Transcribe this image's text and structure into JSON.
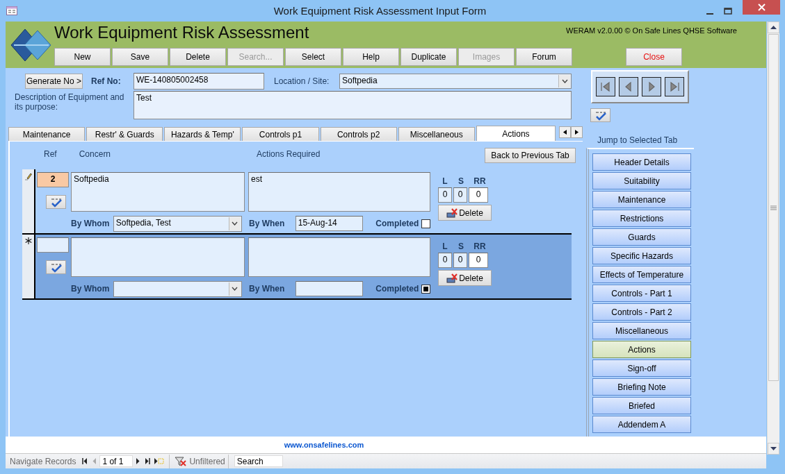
{
  "window": {
    "title": "Work Equipment Risk Assessment Input Form"
  },
  "header": {
    "title": "Work Equipment Risk Assessment",
    "version": "WERAM v2.0.00 © On Safe Lines QHSE Software",
    "buttons": [
      {
        "label": "New",
        "disabled": false
      },
      {
        "label": "Save",
        "disabled": false
      },
      {
        "label": "Delete",
        "disabled": false
      },
      {
        "label": "Search...",
        "disabled": true
      },
      {
        "label": "Select",
        "disabled": false
      },
      {
        "label": "Help",
        "disabled": false
      },
      {
        "label": "Duplicate",
        "disabled": false
      },
      {
        "label": "Images",
        "disabled": true
      },
      {
        "label": "Forum",
        "disabled": false
      }
    ],
    "close_button": "Close"
  },
  "record": {
    "generate_button": "Generate No >",
    "ref_label": "Ref No:",
    "ref_value": "WE-140805002458",
    "location_label": "Location / Site:",
    "location_value": "Softpedia",
    "description_label": "Description of Equipment and its purpose:",
    "description_value": "Test"
  },
  "tabs": [
    {
      "label": "Maintenance",
      "selected": false
    },
    {
      "label": "Restr' & Guards",
      "selected": false
    },
    {
      "label": "Hazards & Temp'",
      "selected": false
    },
    {
      "label": "Controls p1",
      "selected": false
    },
    {
      "label": "Controls p2",
      "selected": false
    },
    {
      "label": "Miscellaneous",
      "selected": false
    },
    {
      "label": "Actions",
      "selected": true
    }
  ],
  "actions": {
    "columns": {
      "ref": "Ref",
      "concern": "Concern",
      "actions": "Actions Required"
    },
    "back_button": "Back to Previous Tab",
    "rows": [
      {
        "kind": "edited",
        "selected": false,
        "ref": "2",
        "concern": "Softpedia",
        "actions": "est",
        "l_label": "L",
        "s_label": "S",
        "rr_label": "RR",
        "l": "0",
        "s": "0",
        "rr": "0",
        "delete_button": "Delete",
        "by_whom_label": "By Whom",
        "by_whom": "Softpedia, Test",
        "by_when_label": "By When",
        "by_when": "15-Aug-14",
        "completed_label": "Completed",
        "completed": false,
        "indeterminate": false
      },
      {
        "kind": "new",
        "selected": true,
        "l_label": "L",
        "s_label": "S",
        "rr_label": "RR",
        "l": "0",
        "s": "0",
        "rr": "0",
        "delete_button": "Delete",
        "by_whom_label": "By Whom",
        "by_when_label": "By When",
        "completed_label": "Completed",
        "completed": false,
        "indeterminate": true
      }
    ]
  },
  "jump": {
    "title": "Jump to Selected Tab",
    "items": [
      {
        "label": "Header Details",
        "selected": false
      },
      {
        "label": "Suitability",
        "selected": false
      },
      {
        "label": "Maintenance",
        "selected": false
      },
      {
        "label": "Restrictions",
        "selected": false
      },
      {
        "label": "Guards",
        "selected": false
      },
      {
        "label": "Specific Hazards",
        "selected": false
      },
      {
        "label": "Effects of Temperature",
        "selected": false
      },
      {
        "label": "Controls - Part 1",
        "selected": false
      },
      {
        "label": "Controls - Part 2",
        "selected": false
      },
      {
        "label": "Miscellaneous",
        "selected": false
      },
      {
        "label": "Actions",
        "selected": true
      },
      {
        "label": "Sign-off",
        "selected": false
      },
      {
        "label": "Briefing Note",
        "selected": false
      },
      {
        "label": "Briefed",
        "selected": false
      },
      {
        "label": "Addendem A",
        "selected": false
      }
    ]
  },
  "footer": {
    "link": "www.onsafelines.com"
  },
  "status_bar": {
    "label": "Navigate Records",
    "position": "1 of 1",
    "filter": "Unfiltered",
    "search_placeholder": "Search"
  }
}
